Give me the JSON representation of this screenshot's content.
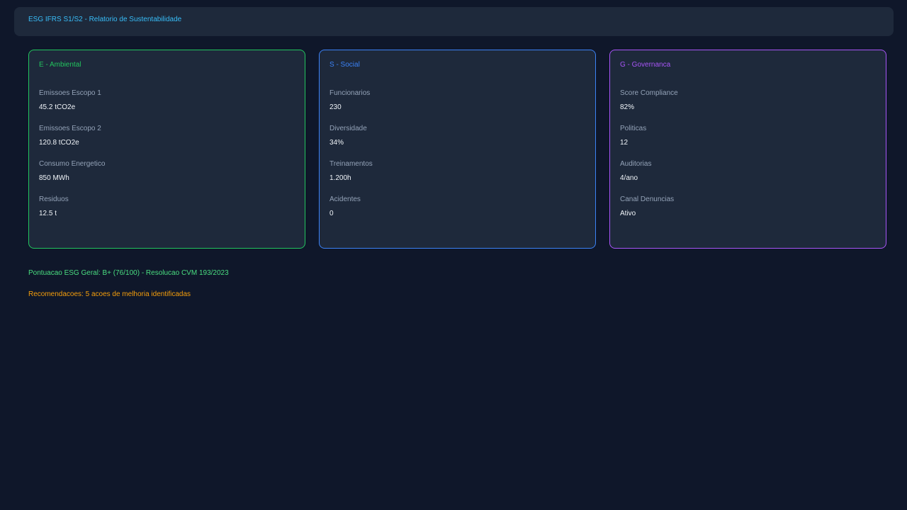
{
  "header": {
    "title": "ESG IFRS S1/S2 - Relatorio de Sustentabilidade"
  },
  "colors": {
    "accent_header": "#38bdf8",
    "environmental": "#22c55e",
    "social": "#3b82f6",
    "governance": "#a855f7",
    "score": "#4ade80",
    "recommendations": "#f59e0b"
  },
  "cards": [
    {
      "title": "E - Ambiental",
      "metrics": [
        {
          "label": "Emissoes Escopo 1",
          "value": "45.2 tCO2e"
        },
        {
          "label": "Emissoes Escopo 2",
          "value": "120.8 tCO2e"
        },
        {
          "label": "Consumo Energetico",
          "value": "850 MWh"
        },
        {
          "label": "Residuos",
          "value": "12.5 t"
        }
      ]
    },
    {
      "title": "S - Social",
      "metrics": [
        {
          "label": "Funcionarios",
          "value": "230"
        },
        {
          "label": "Diversidade",
          "value": "34%"
        },
        {
          "label": "Treinamentos",
          "value": "1.200h"
        },
        {
          "label": "Acidentes",
          "value": "0"
        }
      ]
    },
    {
      "title": "G - Governanca",
      "metrics": [
        {
          "label": "Score Compliance",
          "value": "82%"
        },
        {
          "label": "Politicas",
          "value": "12"
        },
        {
          "label": "Auditorias",
          "value": "4/ano"
        },
        {
          "label": "Canal Denuncias",
          "value": "Ativo"
        }
      ]
    }
  ],
  "footer": {
    "score": "Pontuacao ESG Geral: B+ (76/100) - Resolucao CVM 193/2023",
    "recommendations": "Recomendacoes: 5 acoes de melhoria identificadas"
  }
}
